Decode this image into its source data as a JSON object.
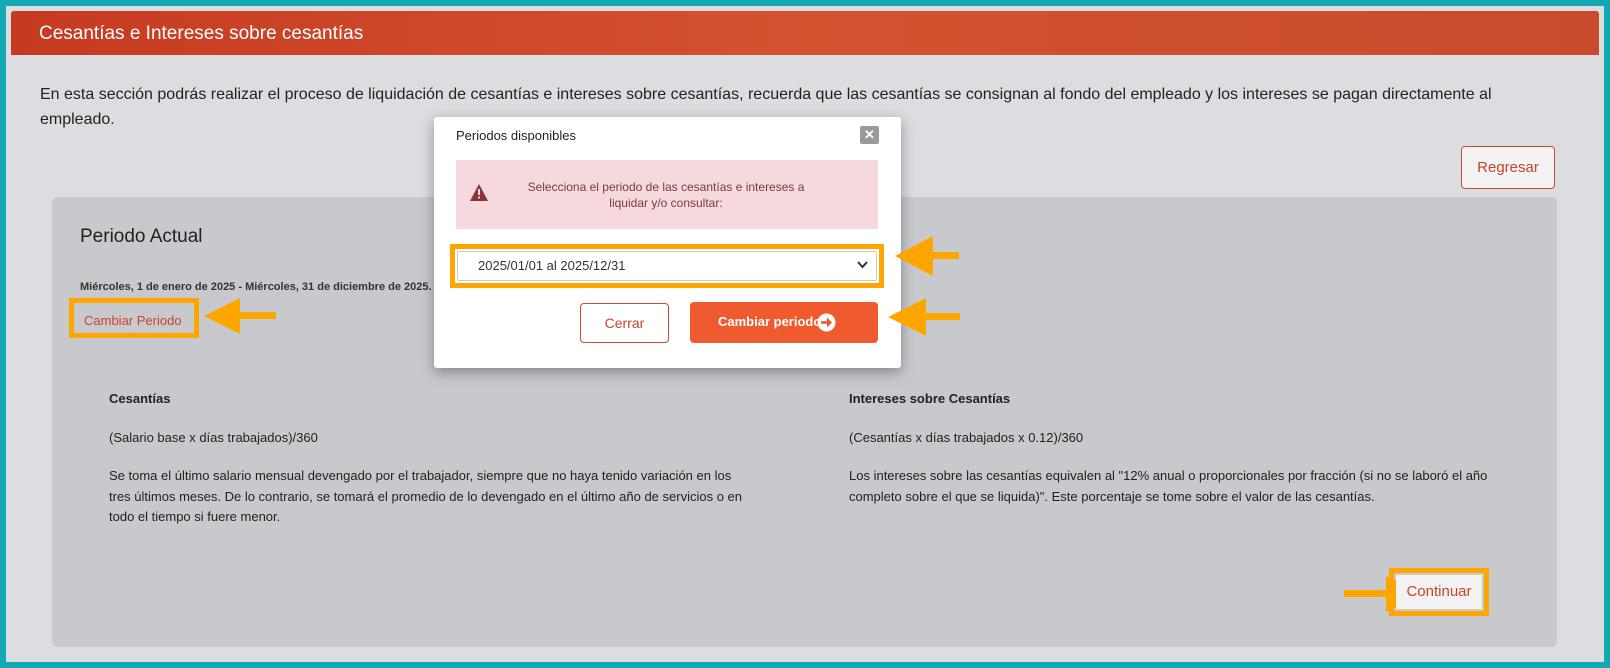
{
  "header": {
    "title": "Cesantías e Intereses sobre cesantías"
  },
  "intro": {
    "text": "En esta sección podrás realizar el proceso de liquidación de cesantías e intereses sobre cesantías, recuerda que las cesantías se consignan al fondo del empleado y los intereses se pagan directamente al empleado."
  },
  "toolbar": {
    "regresar_label": "Regresar"
  },
  "periodo": {
    "title": "Periodo Actual",
    "dates": "Miércoles, 1 de enero de 2025 - Miércoles, 31 de diciembre de 2025.",
    "cambiar_link": "Cambiar Periodo"
  },
  "cesantias": {
    "heading": "Cesantías",
    "formula": "(Salario base x días trabajados)/360",
    "description": "Se toma el último salario mensual devengado por el trabajador, siempre que no haya tenido variación en los tres últimos meses. De lo contrario, se tomará el promedio de lo devengado en el último año de servicios o en todo el tiempo si fuere menor."
  },
  "intereses": {
    "heading": "Intereses sobre Cesantías",
    "formula": "(Cesantías x días trabajados x 0.12)/360",
    "description": "Los intereses sobre las cesantías equivalen al \"12% anual o proporcionales por fracción (si no se laboró el año completo sobre el que se liquida)\". Este porcentaje se tome sobre el valor de las cesantías."
  },
  "continuar_label": "Continuar",
  "modal": {
    "title": "Periodos disponibles",
    "close_icon": "close-icon",
    "alert_icon": "warning-icon",
    "alert_text": "Selecciona el periodo de las cesantías e intereses a liquidar y/o consultar:",
    "select_value": "2025/01/01 al 2025/12/31",
    "cerrar_label": "Cerrar",
    "cambiar_label": "Cambiar periodo",
    "cambiar_icon": "arrow-right-circle-icon"
  },
  "colors": {
    "header": "#d4532f",
    "accent": "#ef5a2f",
    "link": "#c8442a",
    "highlight": "#ffa500",
    "border_frame": "#13a9b3",
    "alert_bg": "#f6d9dc"
  }
}
